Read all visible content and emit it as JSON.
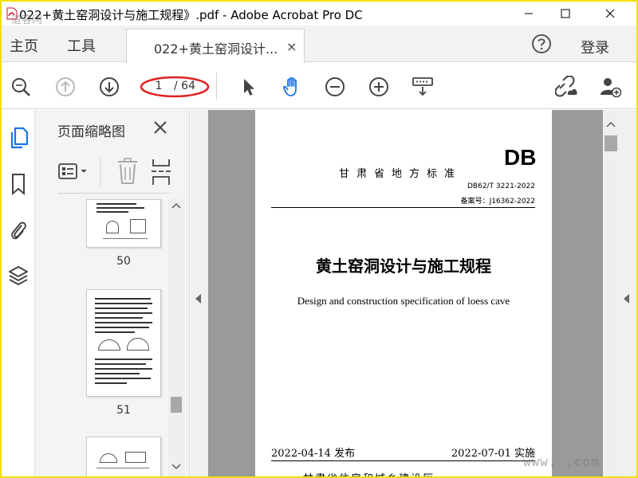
{
  "window": {
    "title": "022+黄土窑洞设计与施工规程》.pdf - Adobe Acrobat Pro DC"
  },
  "menubar": {
    "home": "主页",
    "tools": "工具",
    "tab_label": "022+黄土窑洞设计...",
    "tab_close": "×",
    "login": "登录"
  },
  "toolbar": {
    "current_page": "1",
    "total_pages": "/ 64"
  },
  "panel": {
    "title": "页面缩略图",
    "thumbnails": [
      {
        "label": "50"
      },
      {
        "label": "51"
      }
    ]
  },
  "document": {
    "logo": "DB",
    "province": "甘肃省地方标准",
    "standard_number": "DB62/T 3221-2022",
    "record_number": "备案号：J16362-2022",
    "title_zh": "黄土窑洞设计与施工规程",
    "title_en": "Design and construction specification of loess cave",
    "issued": "2022-04-14 发布",
    "effective": "2022-07-01 实施",
    "publisher": "甘肃省住房和城乡建设厅"
  },
  "watermark": {
    "top_left": "道客网",
    "bottom_right": "www.    .com"
  },
  "colors": {
    "outer_border": "#f0e000",
    "accent_blue": "#1a73e8",
    "annotation_red": "#e02020",
    "doc_background": "#9a9a9a"
  }
}
